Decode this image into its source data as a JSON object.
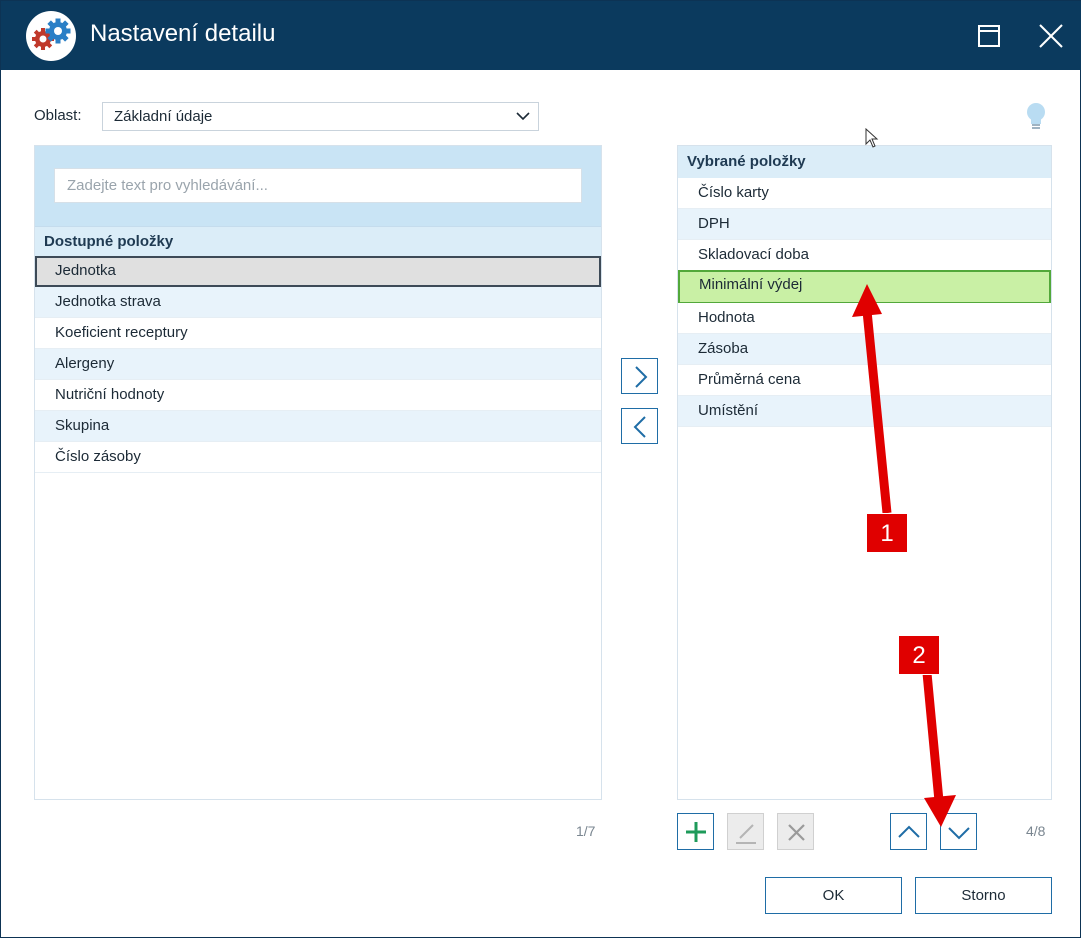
{
  "window": {
    "title": "Nastavení detailu",
    "icons": {
      "app": "gears-icon",
      "maximize": "maximize-icon",
      "close": "close-icon"
    }
  },
  "oblast": {
    "label": "Oblast:",
    "value": "Základní údaje"
  },
  "left_panel": {
    "search_placeholder": "Zadejte text pro vyhledávání...",
    "header": "Dostupné položky",
    "items": [
      {
        "label": "Jednotka",
        "selected": true
      },
      {
        "label": "Jednotka strava"
      },
      {
        "label": "Koeficient receptury"
      },
      {
        "label": "Alergeny"
      },
      {
        "label": "Nutriční hodnoty"
      },
      {
        "label": "Skupina"
      },
      {
        "label": "Číslo zásoby"
      }
    ],
    "counter": "1/7"
  },
  "right_panel": {
    "header": "Vybrané položky",
    "items": [
      {
        "label": "Číslo karty"
      },
      {
        "label": "DPH"
      },
      {
        "label": "Skladovací doba"
      },
      {
        "label": "Minimální výdej",
        "selected": true
      },
      {
        "label": "Hodnota"
      },
      {
        "label": "Zásoba"
      },
      {
        "label": "Průměrná cena"
      },
      {
        "label": "Umístění"
      }
    ],
    "counter": "4/8"
  },
  "buttons": {
    "ok": "OK",
    "storno": "Storno"
  },
  "annotations": {
    "badge1": "1",
    "badge2": "2"
  },
  "colors": {
    "titlebar": "#0b3a5e",
    "accent": "#1f6da6",
    "selected_green": "#c9f0a5",
    "annotation_red": "#e00000"
  }
}
